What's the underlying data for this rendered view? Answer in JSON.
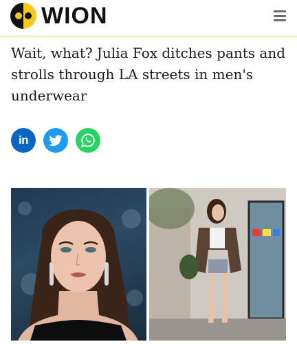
{
  "header": {
    "logo_text": "WION",
    "logo_colors": {
      "yellow": "#f5c81a",
      "black": "#111111"
    },
    "menu_icon": "hamburger-menu-icon"
  },
  "article": {
    "headline": "Wait, what? Julia Fox ditches pants and strolls through LA streets in men's underwear"
  },
  "share": [
    {
      "name": "linkedin",
      "label": "in",
      "icon": "linkedin-icon",
      "color": "#0a66c2"
    },
    {
      "name": "twitter",
      "icon": "twitter-icon",
      "color": "#1d9bf0"
    },
    {
      "name": "whatsapp",
      "icon": "whatsapp-icon",
      "color": "#25d366"
    }
  ],
  "hero_image": {
    "panels": [
      "portrait",
      "street-walk"
    ]
  }
}
